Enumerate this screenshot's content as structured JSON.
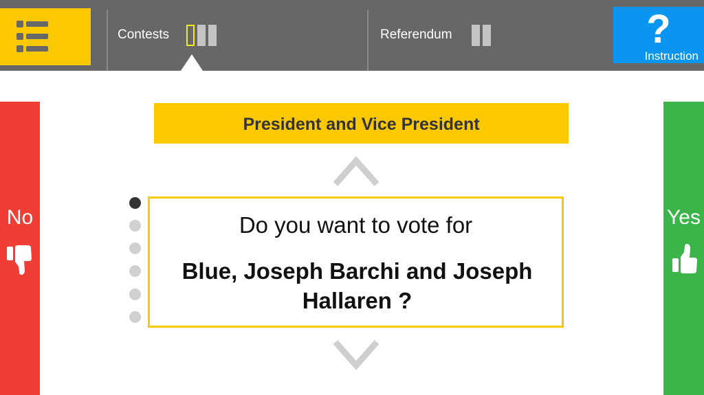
{
  "topbar": {
    "menu_icon": "list-icon",
    "tabs": [
      {
        "label": "Contests",
        "current_index": 0,
        "count": 3
      },
      {
        "label": "Referendum",
        "current_index": -1,
        "count": 2
      }
    ],
    "help": {
      "symbol": "?",
      "label": "Instruction",
      "icon": "question-mark-icon"
    }
  },
  "contest": {
    "title": "President and Vice President"
  },
  "question": {
    "prompt": "Do you want to vote for",
    "candidate": "Blue, Joseph Barchi and Joseph Hallaren ?"
  },
  "answers": {
    "no": {
      "label": "No",
      "icon": "thumbs-down-icon"
    },
    "yes": {
      "label": "Yes",
      "icon": "thumbs-up-icon"
    }
  },
  "pagination": {
    "total": 6,
    "active_index": 0
  },
  "colors": {
    "topbar": "#676767",
    "accent_yellow": "#fcc800",
    "help_blue": "#0a96f0",
    "no_red": "#ee3e36",
    "yes_green": "#3bb54a"
  }
}
